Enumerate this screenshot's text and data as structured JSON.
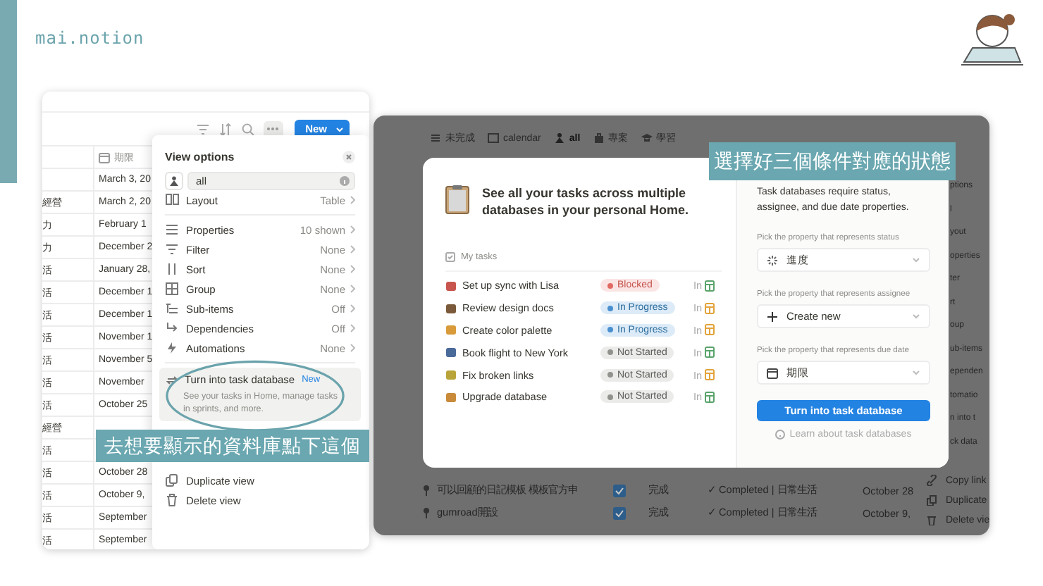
{
  "logo": {
    "text": "mai.notion"
  },
  "table_view": {
    "new_button": "New",
    "date_column": "期限",
    "rows": [
      {
        "date": "March 3, 20"
      },
      {
        "column_1": "經營",
        "date": "March 2, 20"
      },
      {
        "column_1": "力",
        "date": "February 1"
      },
      {
        "column_1": "力",
        "date": "December 2"
      },
      {
        "column_1": "活",
        "date": "January 28,"
      },
      {
        "column_1": "活",
        "date": "December 1"
      },
      {
        "column_1": "活",
        "date": "December 1"
      },
      {
        "column_1": "活",
        "date": "November 1"
      },
      {
        "column_1": "活",
        "date": "November 5"
      },
      {
        "column_1": "活",
        "date": "November"
      },
      {
        "column_1": "活",
        "date": "October 25"
      },
      {
        "column_1": "經營"
      },
      {
        "column_1": "活"
      },
      {
        "column_1": "活",
        "date": "October 28"
      },
      {
        "column_1": "活",
        "date": "October 9,"
      },
      {
        "column_1": "活",
        "date": "September"
      },
      {
        "column_1": "活",
        "date": "September"
      }
    ]
  },
  "view_options": {
    "title": "View options",
    "view_name": "all",
    "items": [
      {
        "label": "Layout",
        "value": "Table"
      },
      {
        "label": "Properties",
        "value": "10 shown"
      },
      {
        "label": "Filter",
        "value": "None"
      },
      {
        "label": "Sort",
        "value": "None"
      },
      {
        "label": "Group",
        "value": "None"
      },
      {
        "label": "Sub-items",
        "value": "Off"
      },
      {
        "label": "Dependencies",
        "value": "Off"
      },
      {
        "label": "Automations",
        "value": "None"
      }
    ],
    "task_database": {
      "label": "Turn into task database",
      "badge": "New",
      "description": "See your tasks in Home, manage tasks in sprints, and more."
    },
    "actions": [
      "Duplicate view",
      "Delete view"
    ]
  },
  "background": {
    "view_tabs": [
      {
        "label": "未完成",
        "selected": false
      },
      {
        "label": "calendar",
        "selected": false
      },
      {
        "label": "all",
        "selected": true
      },
      {
        "label": "專案",
        "selected": false
      },
      {
        "label": "學習",
        "selected": false
      }
    ],
    "menu_fragments": [
      "ptions",
      "l",
      "yout",
      "operties",
      "ter",
      "rt",
      "oup",
      "ub-items",
      "ependen",
      "tomatio",
      "n into t",
      "ck data"
    ],
    "menu_actions": [
      "Copy link",
      "Duplicate",
      "Delete vie"
    ],
    "rows": [
      {
        "title": "可以回顧的日記模板 模板官方申",
        "done": true,
        "status": "完成",
        "tag": "✓ Completed | 日常生活",
        "date": "October 28"
      },
      {
        "title": "gumroad開設",
        "done": true,
        "status": "完成",
        "tag": "✓ Completed | 日常生活",
        "date": "October 9,"
      }
    ]
  },
  "task_database_dialog": {
    "heading": "See all your tasks across multiple databases in your personal Home.",
    "list_title": "My tasks",
    "tasks": [
      {
        "title": "Set up sync with Lisa",
        "status": "Blocked",
        "kind": "blocked",
        "location": "In",
        "color": "#5aa36b"
      },
      {
        "title": "Review design docs",
        "status": "In Progress",
        "kind": "in_progress",
        "location": "In",
        "color": "#e2a33a"
      },
      {
        "title": "Create color palette",
        "status": "In Progress",
        "kind": "in_progress",
        "location": "In",
        "color": "#e2a33a"
      },
      {
        "title": "Book flight to New York",
        "status": "Not Started",
        "kind": "not_started",
        "location": "In",
        "color": "#5aa36b"
      },
      {
        "title": "Fix broken links",
        "status": "Not Started",
        "kind": "not_started",
        "location": "In",
        "color": "#e2a33a"
      },
      {
        "title": "Upgrade database",
        "status": "Not Started",
        "kind": "not_started",
        "location": "In",
        "color": "#5aa36b"
      }
    ],
    "requirement_note": "Task databases require status, assignee, and due date properties.",
    "property_pickers": [
      {
        "label": "Pick the property that represents status",
        "value": "進度"
      },
      {
        "label": "Pick the property that represents assignee",
        "value": "Create new"
      },
      {
        "label": "Pick the property that represents due date",
        "value": "期限"
      }
    ],
    "confirm_button": "Turn into task database",
    "help_link": "Learn about task databases"
  },
  "annotations": [
    {
      "text": "去想要顯示的資料庫點下這個"
    },
    {
      "text": "選擇好三個條件對應的狀態"
    }
  ]
}
